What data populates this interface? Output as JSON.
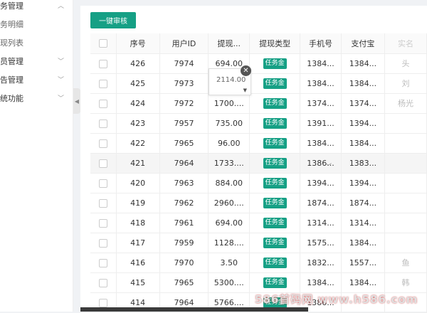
{
  "sidebar": {
    "items": [
      {
        "label": "务管理",
        "type": "group"
      },
      {
        "label": "务明细",
        "type": "sub"
      },
      {
        "label": "现列表",
        "type": "sub"
      },
      {
        "label": "员管理",
        "type": "group"
      },
      {
        "label": "告管理",
        "type": "group"
      },
      {
        "label": "统功能",
        "type": "group"
      }
    ]
  },
  "toolbar": {
    "batch_label": "一键审核"
  },
  "table": {
    "headers": [
      "序号",
      "用户ID",
      "提现...",
      "提现类型",
      "手机号",
      "支付宝",
      "实名"
    ],
    "rows": [
      {
        "id": "426",
        "uid": "7974",
        "amount": "694.00",
        "type": "任务金",
        "phone": "1384...",
        "alipay": "1384...",
        "extra": "头"
      },
      {
        "id": "425",
        "uid": "7973",
        "amount": "",
        "type": "任务金",
        "phone": "1384...",
        "alipay": "1384...",
        "extra": "刘"
      },
      {
        "id": "424",
        "uid": "7972",
        "amount": "1700....",
        "type": "任务金",
        "phone": "1374...",
        "alipay": "1374...",
        "extra": "杨光"
      },
      {
        "id": "423",
        "uid": "7957",
        "amount": "735.00",
        "type": "任务金",
        "phone": "1391...",
        "alipay": "1394...",
        "extra": ""
      },
      {
        "id": "422",
        "uid": "7965",
        "amount": "96.00",
        "type": "任务金",
        "phone": "1384...",
        "alipay": "1384...",
        "extra": ""
      },
      {
        "id": "421",
        "uid": "7964",
        "amount": "1733....",
        "type": "任务金",
        "phone": "1386...",
        "alipay": "1383...",
        "extra": ""
      },
      {
        "id": "420",
        "uid": "7963",
        "amount": "884.00",
        "type": "任务金",
        "phone": "1394...",
        "alipay": "1394...",
        "extra": ""
      },
      {
        "id": "419",
        "uid": "7962",
        "amount": "2960....",
        "type": "任务金",
        "phone": "1874...",
        "alipay": "1874...",
        "extra": ""
      },
      {
        "id": "418",
        "uid": "7961",
        "amount": "694.00",
        "type": "任务金",
        "phone": "1314...",
        "alipay": "1314...",
        "extra": ""
      },
      {
        "id": "417",
        "uid": "7959",
        "amount": "1128....",
        "type": "任务金",
        "phone": "1575...",
        "alipay": "1384...",
        "extra": ""
      },
      {
        "id": "416",
        "uid": "7970",
        "amount": "3.50",
        "type": "任务金",
        "phone": "1832...",
        "alipay": "1557...",
        "extra": "鱼"
      },
      {
        "id": "415",
        "uid": "7965",
        "amount": "5300....",
        "type": "任务金",
        "phone": "1384...",
        "alipay": "1384...",
        "extra": "韩"
      },
      {
        "id": "414",
        "uid": "7964",
        "amount": "5766....",
        "type": "任务金",
        "phone": "1386...",
        "alipay": "",
        "extra": ""
      }
    ]
  },
  "edit_popup": {
    "value": "2114.00"
  },
  "watermark": "586首码网 www.h586.com"
}
